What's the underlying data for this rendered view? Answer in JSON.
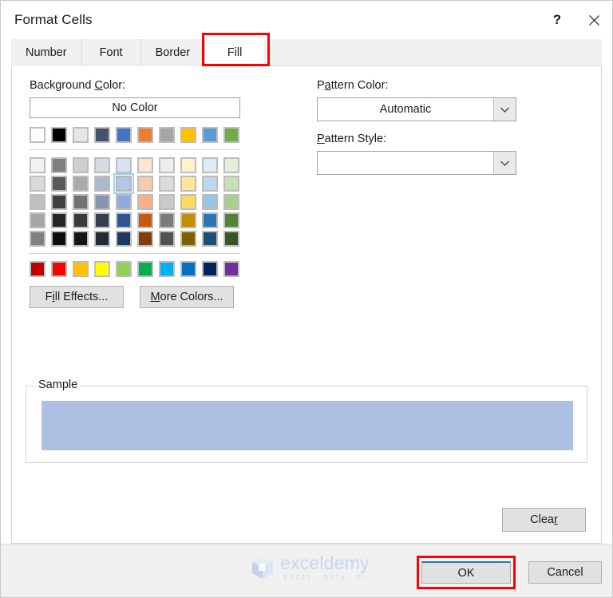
{
  "window": {
    "title": "Format Cells",
    "help_button": "?",
    "close_button": "close-icon"
  },
  "tabs": [
    {
      "label": "Number",
      "active": false
    },
    {
      "label": "Font",
      "active": false
    },
    {
      "label": "Border",
      "active": false
    },
    {
      "label": "Fill",
      "active": true
    }
  ],
  "annotations": {
    "highlight_color": "#ff0000",
    "targets": [
      "fill-tab",
      "ok-button"
    ]
  },
  "fill_tab": {
    "background_color": {
      "label": "Background Color:",
      "label_prefix": "Background ",
      "label_accel": "C",
      "label_suffix": "olor:",
      "no_color_button": "No Color",
      "theme_row": [
        "#ffffff",
        "#000000",
        "#e7e6e6",
        "#44546a",
        "#4472c4",
        "#ed7d31",
        "#a5a5a5",
        "#ffc000",
        "#5b9bd5",
        "#70ad47"
      ],
      "tint_rows": [
        [
          "#f2f2f2",
          "#7f7f7f",
          "#d0cece",
          "#d6dce4",
          "#d9e2f3",
          "#fbe5d5",
          "#ededed",
          "#fff2cc",
          "#ddebf7",
          "#e2efd9"
        ],
        [
          "#d9d9d9",
          "#595959",
          "#aeaaaa",
          "#adb9ca",
          "#b4c6e7",
          "#f7cbac",
          "#dbdbdb",
          "#ffe699",
          "#bdd7ee",
          "#c5e0b3"
        ],
        [
          "#bfbfbf",
          "#3f3f3f",
          "#757171",
          "#8496b0",
          "#8faadc",
          "#f4b183",
          "#c9c9c9",
          "#ffd966",
          "#9cc3e5",
          "#a8d08d"
        ],
        [
          "#a6a6a6",
          "#262626",
          "#3a3838",
          "#333f4f",
          "#2f5496",
          "#c55a11",
          "#7b7b7b",
          "#bf8f00",
          "#2e75b6",
          "#538135"
        ],
        [
          "#808080",
          "#0d0d0d",
          "#171616",
          "#222a35",
          "#1f3864",
          "#833c0b",
          "#525252",
          "#7f6000",
          "#1f4e79",
          "#375623"
        ]
      ],
      "standard_row": [
        "#c00000",
        "#ff0000",
        "#ffc000",
        "#ffff00",
        "#92d050",
        "#00b050",
        "#00b0f0",
        "#0070c0",
        "#002060",
        "#7030a0"
      ],
      "selected_swatch": {
        "row": 1,
        "col": 4,
        "color": "#b4c6e7"
      }
    },
    "pattern_color": {
      "label": "Pattern Color:",
      "label_prefix": "P",
      "label_accel": "a",
      "label_suffix": "ttern Color:",
      "value": "Automatic",
      "arrow_icon": "chevron-down-icon"
    },
    "pattern_style": {
      "label": "Pattern Style:",
      "label_prefix": "",
      "label_accel": "P",
      "label_suffix": "attern Style:",
      "value": "",
      "arrow_icon": "chevron-down-icon"
    },
    "fill_effects_button": "Fill Effects...",
    "more_colors_button": "More Colors...",
    "sample": {
      "legend": "Sample",
      "color": "#adc0e4"
    },
    "clear_button": "Clear"
  },
  "footer": {
    "ok_button": "OK",
    "cancel_button": "Cancel",
    "watermark": {
      "name": "exceldemy",
      "tagline": "EXCEL - DATA - BI"
    }
  }
}
